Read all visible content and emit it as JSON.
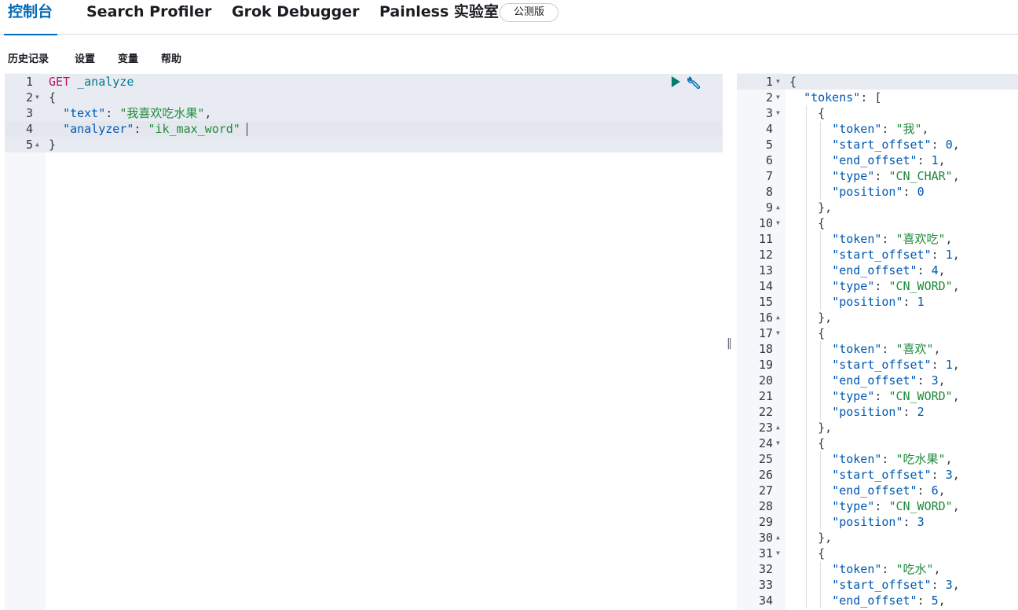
{
  "tabs": [
    {
      "label": "控制台",
      "active": true
    },
    {
      "label": "Search Profiler",
      "active": false
    },
    {
      "label": "Grok Debugger",
      "active": false
    },
    {
      "label": "Painless 实验室",
      "active": false
    }
  ],
  "beta_badge": "公测版",
  "menu": [
    "历史记录",
    "设置",
    "变量",
    "帮助"
  ],
  "request_editor": {
    "line_numbers": [
      "1",
      "2",
      "3",
      "4",
      "5"
    ],
    "lines": [
      [
        {
          "t": "GET",
          "c": "k-method"
        },
        {
          "t": " ",
          "c": "k-punc"
        },
        {
          "t": "_analyze",
          "c": "k-url"
        }
      ],
      [
        {
          "t": "{",
          "c": "k-punc"
        }
      ],
      [
        {
          "t": "  ",
          "c": "k-punc"
        },
        {
          "t": "\"text\"",
          "c": "k-key"
        },
        {
          "t": ": ",
          "c": "k-punc"
        },
        {
          "t": "\"我喜欢吃水果\"",
          "c": "k-str"
        },
        {
          "t": ",",
          "c": "k-punc"
        }
      ],
      [
        {
          "t": "  ",
          "c": "k-punc"
        },
        {
          "t": "\"analyzer\"",
          "c": "k-key"
        },
        {
          "t": ": ",
          "c": "k-punc"
        },
        {
          "t": "\"ik_max_word\"",
          "c": "k-str"
        }
      ],
      [
        {
          "t": "}",
          "c": "k-punc"
        }
      ]
    ]
  },
  "response_editor": {
    "line_numbers": [
      "1",
      "2",
      "3",
      "4",
      "5",
      "6",
      "7",
      "8",
      "9",
      "10",
      "11",
      "12",
      "13",
      "14",
      "15",
      "16",
      "17",
      "18",
      "19",
      "20",
      "21",
      "22",
      "23",
      "24",
      "25",
      "26",
      "27",
      "28",
      "29",
      "30",
      "31",
      "32",
      "33",
      "34"
    ],
    "lines": [
      [
        {
          "t": "{",
          "c": "k-punc"
        }
      ],
      [
        {
          "t": "  ",
          "c": "k-punc"
        },
        {
          "t": "\"tokens\"",
          "c": "k-key"
        },
        {
          "t": ": [",
          "c": "k-punc"
        }
      ],
      [
        {
          "t": "    {",
          "c": "k-punc"
        }
      ],
      [
        {
          "t": "      ",
          "c": "k-punc"
        },
        {
          "t": "\"token\"",
          "c": "k-key"
        },
        {
          "t": ": ",
          "c": "k-punc"
        },
        {
          "t": "\"我\"",
          "c": "k-str"
        },
        {
          "t": ",",
          "c": "k-punc"
        }
      ],
      [
        {
          "t": "      ",
          "c": "k-punc"
        },
        {
          "t": "\"start_offset\"",
          "c": "k-key"
        },
        {
          "t": ": ",
          "c": "k-punc"
        },
        {
          "t": "0",
          "c": "k-num"
        },
        {
          "t": ",",
          "c": "k-punc"
        }
      ],
      [
        {
          "t": "      ",
          "c": "k-punc"
        },
        {
          "t": "\"end_offset\"",
          "c": "k-key"
        },
        {
          "t": ": ",
          "c": "k-punc"
        },
        {
          "t": "1",
          "c": "k-num"
        },
        {
          "t": ",",
          "c": "k-punc"
        }
      ],
      [
        {
          "t": "      ",
          "c": "k-punc"
        },
        {
          "t": "\"type\"",
          "c": "k-key"
        },
        {
          "t": ": ",
          "c": "k-punc"
        },
        {
          "t": "\"CN_CHAR\"",
          "c": "k-str"
        },
        {
          "t": ",",
          "c": "k-punc"
        }
      ],
      [
        {
          "t": "      ",
          "c": "k-punc"
        },
        {
          "t": "\"position\"",
          "c": "k-key"
        },
        {
          "t": ": ",
          "c": "k-punc"
        },
        {
          "t": "0",
          "c": "k-num"
        }
      ],
      [
        {
          "t": "    },",
          "c": "k-punc"
        }
      ],
      [
        {
          "t": "    {",
          "c": "k-punc"
        }
      ],
      [
        {
          "t": "      ",
          "c": "k-punc"
        },
        {
          "t": "\"token\"",
          "c": "k-key"
        },
        {
          "t": ": ",
          "c": "k-punc"
        },
        {
          "t": "\"喜欢吃\"",
          "c": "k-str"
        },
        {
          "t": ",",
          "c": "k-punc"
        }
      ],
      [
        {
          "t": "      ",
          "c": "k-punc"
        },
        {
          "t": "\"start_offset\"",
          "c": "k-key"
        },
        {
          "t": ": ",
          "c": "k-punc"
        },
        {
          "t": "1",
          "c": "k-num"
        },
        {
          "t": ",",
          "c": "k-punc"
        }
      ],
      [
        {
          "t": "      ",
          "c": "k-punc"
        },
        {
          "t": "\"end_offset\"",
          "c": "k-key"
        },
        {
          "t": ": ",
          "c": "k-punc"
        },
        {
          "t": "4",
          "c": "k-num"
        },
        {
          "t": ",",
          "c": "k-punc"
        }
      ],
      [
        {
          "t": "      ",
          "c": "k-punc"
        },
        {
          "t": "\"type\"",
          "c": "k-key"
        },
        {
          "t": ": ",
          "c": "k-punc"
        },
        {
          "t": "\"CN_WORD\"",
          "c": "k-str"
        },
        {
          "t": ",",
          "c": "k-punc"
        }
      ],
      [
        {
          "t": "      ",
          "c": "k-punc"
        },
        {
          "t": "\"position\"",
          "c": "k-key"
        },
        {
          "t": ": ",
          "c": "k-punc"
        },
        {
          "t": "1",
          "c": "k-num"
        }
      ],
      [
        {
          "t": "    },",
          "c": "k-punc"
        }
      ],
      [
        {
          "t": "    {",
          "c": "k-punc"
        }
      ],
      [
        {
          "t": "      ",
          "c": "k-punc"
        },
        {
          "t": "\"token\"",
          "c": "k-key"
        },
        {
          "t": ": ",
          "c": "k-punc"
        },
        {
          "t": "\"喜欢\"",
          "c": "k-str"
        },
        {
          "t": ",",
          "c": "k-punc"
        }
      ],
      [
        {
          "t": "      ",
          "c": "k-punc"
        },
        {
          "t": "\"start_offset\"",
          "c": "k-key"
        },
        {
          "t": ": ",
          "c": "k-punc"
        },
        {
          "t": "1",
          "c": "k-num"
        },
        {
          "t": ",",
          "c": "k-punc"
        }
      ],
      [
        {
          "t": "      ",
          "c": "k-punc"
        },
        {
          "t": "\"end_offset\"",
          "c": "k-key"
        },
        {
          "t": ": ",
          "c": "k-punc"
        },
        {
          "t": "3",
          "c": "k-num"
        },
        {
          "t": ",",
          "c": "k-punc"
        }
      ],
      [
        {
          "t": "      ",
          "c": "k-punc"
        },
        {
          "t": "\"type\"",
          "c": "k-key"
        },
        {
          "t": ": ",
          "c": "k-punc"
        },
        {
          "t": "\"CN_WORD\"",
          "c": "k-str"
        },
        {
          "t": ",",
          "c": "k-punc"
        }
      ],
      [
        {
          "t": "      ",
          "c": "k-punc"
        },
        {
          "t": "\"position\"",
          "c": "k-key"
        },
        {
          "t": ": ",
          "c": "k-punc"
        },
        {
          "t": "2",
          "c": "k-num"
        }
      ],
      [
        {
          "t": "    },",
          "c": "k-punc"
        }
      ],
      [
        {
          "t": "    {",
          "c": "k-punc"
        }
      ],
      [
        {
          "t": "      ",
          "c": "k-punc"
        },
        {
          "t": "\"token\"",
          "c": "k-key"
        },
        {
          "t": ": ",
          "c": "k-punc"
        },
        {
          "t": "\"吃水果\"",
          "c": "k-str"
        },
        {
          "t": ",",
          "c": "k-punc"
        }
      ],
      [
        {
          "t": "      ",
          "c": "k-punc"
        },
        {
          "t": "\"start_offset\"",
          "c": "k-key"
        },
        {
          "t": ": ",
          "c": "k-punc"
        },
        {
          "t": "3",
          "c": "k-num"
        },
        {
          "t": ",",
          "c": "k-punc"
        }
      ],
      [
        {
          "t": "      ",
          "c": "k-punc"
        },
        {
          "t": "\"end_offset\"",
          "c": "k-key"
        },
        {
          "t": ": ",
          "c": "k-punc"
        },
        {
          "t": "6",
          "c": "k-num"
        },
        {
          "t": ",",
          "c": "k-punc"
        }
      ],
      [
        {
          "t": "      ",
          "c": "k-punc"
        },
        {
          "t": "\"type\"",
          "c": "k-key"
        },
        {
          "t": ": ",
          "c": "k-punc"
        },
        {
          "t": "\"CN_WORD\"",
          "c": "k-str"
        },
        {
          "t": ",",
          "c": "k-punc"
        }
      ],
      [
        {
          "t": "      ",
          "c": "k-punc"
        },
        {
          "t": "\"position\"",
          "c": "k-key"
        },
        {
          "t": ": ",
          "c": "k-punc"
        },
        {
          "t": "3",
          "c": "k-num"
        }
      ],
      [
        {
          "t": "    },",
          "c": "k-punc"
        }
      ],
      [
        {
          "t": "    {",
          "c": "k-punc"
        }
      ],
      [
        {
          "t": "      ",
          "c": "k-punc"
        },
        {
          "t": "\"token\"",
          "c": "k-key"
        },
        {
          "t": ": ",
          "c": "k-punc"
        },
        {
          "t": "\"吃水\"",
          "c": "k-str"
        },
        {
          "t": ",",
          "c": "k-punc"
        }
      ],
      [
        {
          "t": "      ",
          "c": "k-punc"
        },
        {
          "t": "\"start_offset\"",
          "c": "k-key"
        },
        {
          "t": ": ",
          "c": "k-punc"
        },
        {
          "t": "3",
          "c": "k-num"
        },
        {
          "t": ",",
          "c": "k-punc"
        }
      ],
      [
        {
          "t": "      ",
          "c": "k-punc"
        },
        {
          "t": "\"end_offset\"",
          "c": "k-key"
        },
        {
          "t": ": ",
          "c": "k-punc"
        },
        {
          "t": "5",
          "c": "k-num"
        },
        {
          "t": ",",
          "c": "k-punc"
        }
      ]
    ]
  },
  "icons": {
    "run": "play-icon",
    "settings": "wrench-icon",
    "resize": "splitter-grip-icon"
  },
  "colors": {
    "accent": "#006bb8",
    "run": "#017d73",
    "wrench": "#006bb8"
  }
}
